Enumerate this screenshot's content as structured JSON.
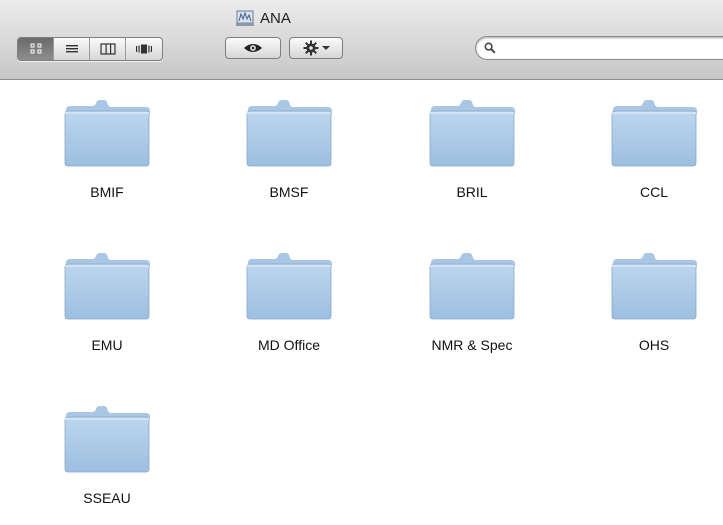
{
  "window": {
    "title": "ANA",
    "title_icon": "network-volume-icon"
  },
  "toolbar": {
    "view_buttons": [
      {
        "name": "icon-view",
        "icon": "icon-view-icon",
        "active": true
      },
      {
        "name": "list-view",
        "icon": "list-view-icon",
        "active": false
      },
      {
        "name": "column-view",
        "icon": "column-view-icon",
        "active": false
      },
      {
        "name": "coverflow-view",
        "icon": "coverflow-view-icon",
        "active": false
      }
    ],
    "quicklook_icon": "eye-icon",
    "action_icon": "gear-icon",
    "action_menu_icon": "chevron-down-icon"
  },
  "search": {
    "icon": "search-icon",
    "value": "",
    "placeholder": ""
  },
  "folders": [
    {
      "label": "BMIF"
    },
    {
      "label": "BMSF"
    },
    {
      "label": "BRIL"
    },
    {
      "label": "CCL"
    },
    {
      "label": "EMU"
    },
    {
      "label": "MD Office"
    },
    {
      "label": "NMR & Spec"
    },
    {
      "label": "OHS"
    },
    {
      "label": "SSEAU"
    }
  ],
  "colors": {
    "folder_body": "#a9c8e4",
    "folder_tab": "#b9d3ea",
    "toolbar_top": "#ececec",
    "toolbar_bottom": "#c6c6c6"
  }
}
